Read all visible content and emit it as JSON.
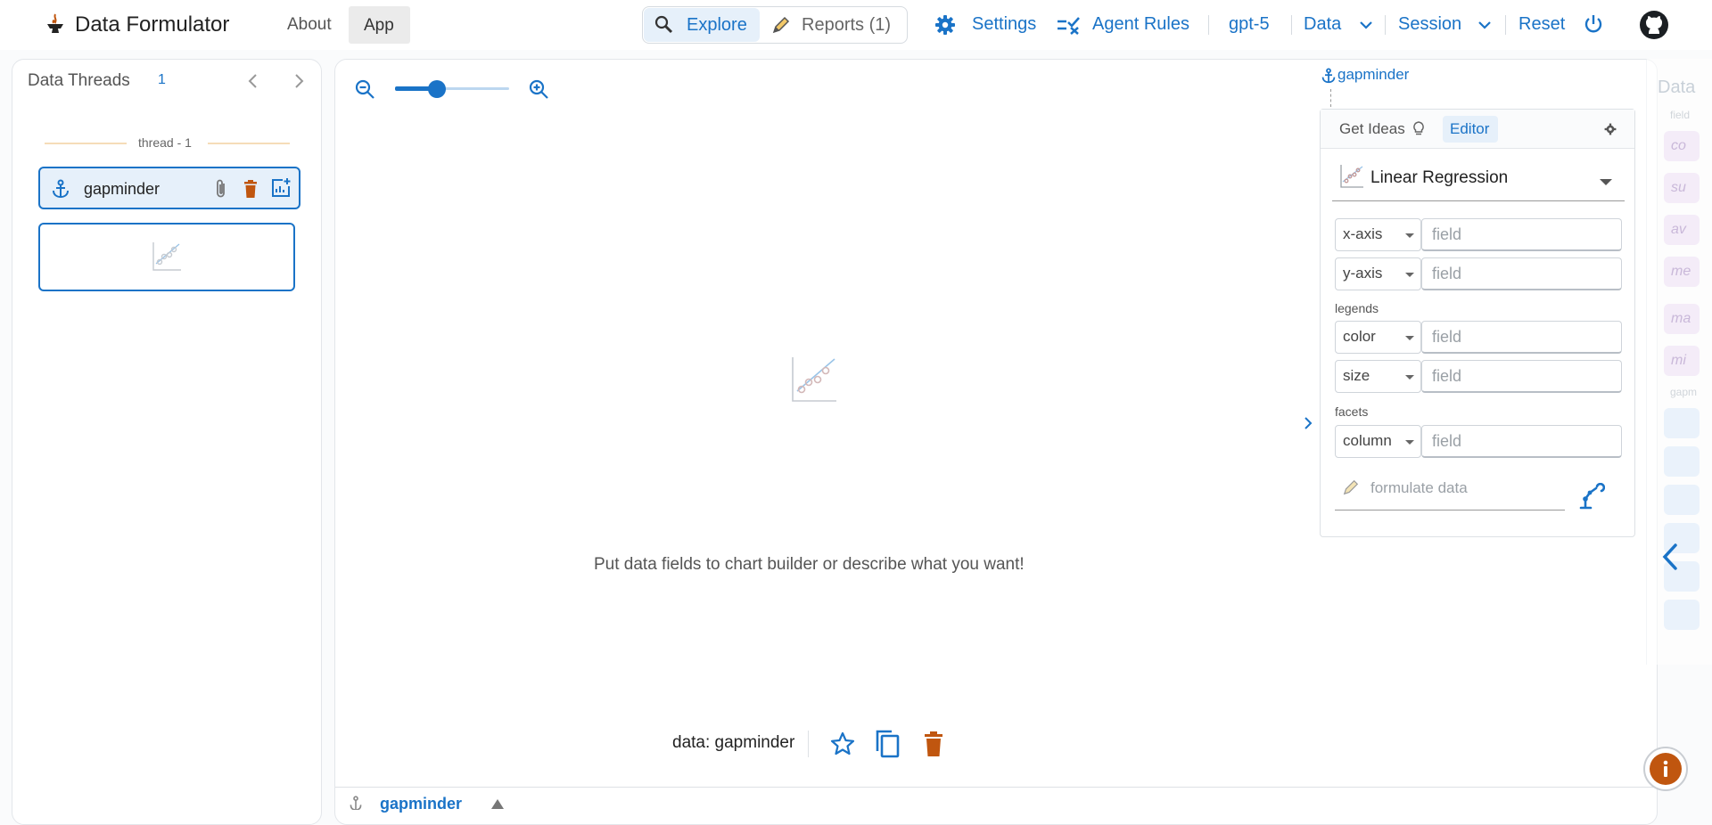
{
  "header": {
    "app_title": "Data Formulator",
    "nav": {
      "about": "About",
      "app": "App"
    },
    "modes": {
      "explore": "Explore",
      "reports": "Reports (1)"
    },
    "settings": "Settings",
    "agent_rules": "Agent Rules",
    "model": "gpt-5",
    "data_menu": "Data",
    "session_menu": "Session",
    "reset": "Reset"
  },
  "threads": {
    "title": "Data Threads",
    "count": "1",
    "thread_label": "thread - 1",
    "table_name": "gapminder"
  },
  "canvas": {
    "zoom_level": 0.37,
    "placeholder": "Put data fields to chart builder or describe what you want!",
    "data_label": "data: gapminder"
  },
  "builder": {
    "anchor_label": "gapminder",
    "tabs": {
      "ideas": "Get Ideas",
      "editor": "Editor"
    },
    "chart_type": "Linear Regression",
    "encodings": [
      {
        "channel": "x-axis",
        "placeholder": "field"
      },
      {
        "channel": "y-axis",
        "placeholder": "field"
      },
      {
        "channel": "color",
        "placeholder": "field"
      },
      {
        "channel": "size",
        "placeholder": "field"
      },
      {
        "channel": "column",
        "placeholder": "field"
      }
    ],
    "legends_label": "legends",
    "facets_label": "facets",
    "formulate_placeholder": "formulate data"
  },
  "data_panel": {
    "title": "Data",
    "section1": "field",
    "fields": [
      "co",
      "su",
      "av",
      "me",
      "ma",
      "mi"
    ],
    "section2": "gapm"
  },
  "bottom": {
    "table_tab": "gapminder"
  },
  "colors": {
    "accent": "#1a73c7",
    "danger": "#c0560f",
    "selection": "#e6f0fa"
  }
}
